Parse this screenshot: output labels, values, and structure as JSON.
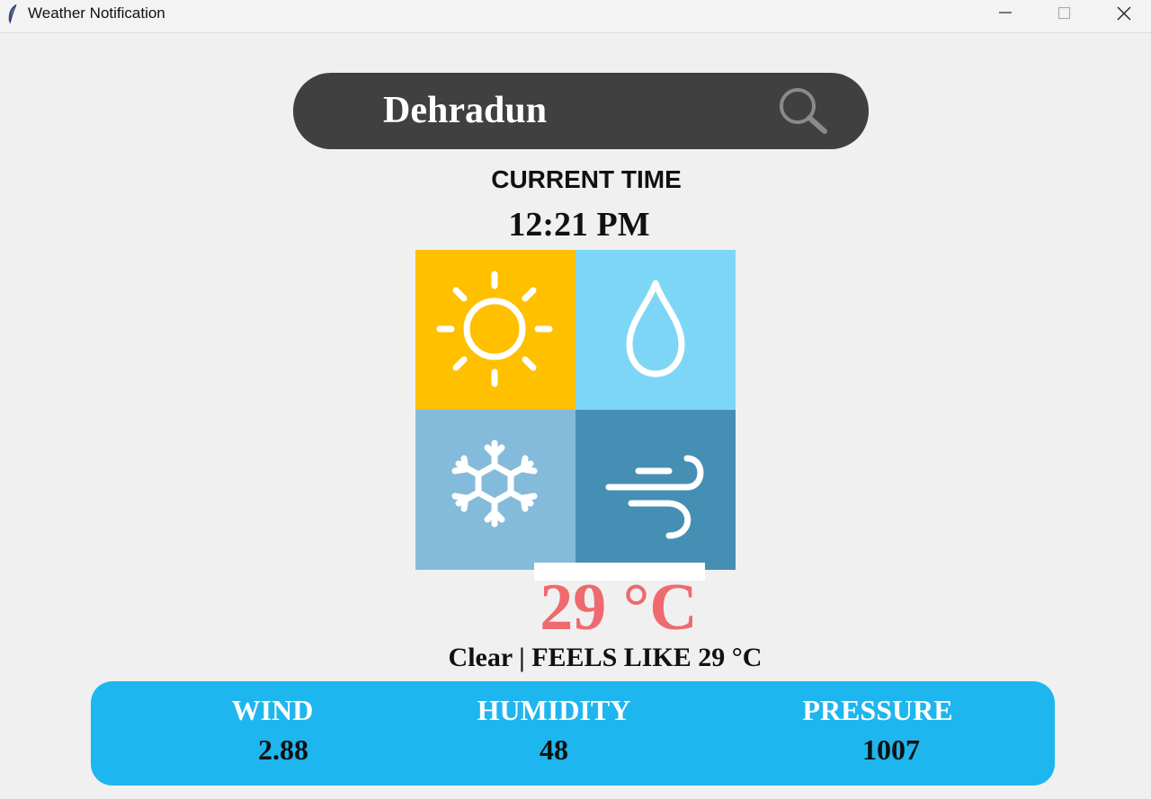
{
  "window": {
    "title": "Weather Notification",
    "controls": [
      "minimize-icon",
      "maximize-icon",
      "close-icon"
    ]
  },
  "search": {
    "value": "Dehradun",
    "icon": "search-icon"
  },
  "time": {
    "label": "CURRENT TIME",
    "value": "12:21 PM"
  },
  "logo": {
    "icons": [
      "sun-icon",
      "water-drop-icon",
      "snowflake-icon",
      "wind-icon"
    ],
    "colors": {
      "sun_tile": "#ffc000",
      "drop_tile": "#7ed6f6",
      "snow_tile": "#85bbda",
      "wind_tile": "#468fb4"
    }
  },
  "weather": {
    "temperature": "29 °C",
    "condition_line": "Clear | FEELS LIKE 29 °C",
    "temp_color": "#ee6a6f"
  },
  "stats": {
    "panel_color": "#1eb6ee",
    "wind": {
      "label": "WIND",
      "value": "2.88"
    },
    "humidity": {
      "label": "HUMIDITY",
      "value": "48"
    },
    "pressure": {
      "label": "PRESSURE",
      "value": "1007"
    }
  }
}
